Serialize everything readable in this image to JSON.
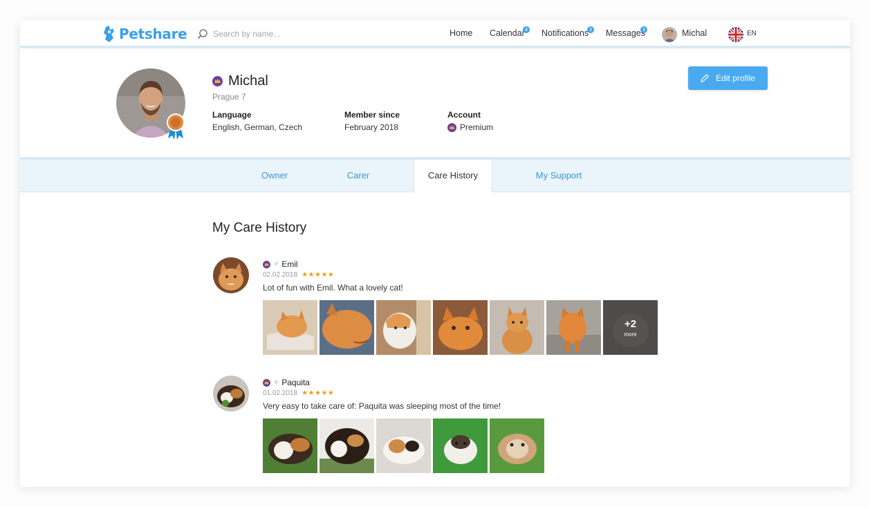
{
  "brand": {
    "name": "Petshare",
    "accent": "#3aa0e6"
  },
  "search": {
    "placeholder": "Search by name..."
  },
  "nav": {
    "home": "Home",
    "calendar": {
      "label": "Calendar",
      "badge": "4"
    },
    "notifications": {
      "label": "Notifications",
      "badge": "3"
    },
    "messages": {
      "label": "Messages",
      "badge": "3"
    },
    "user": "Michal",
    "language": "EN"
  },
  "profile": {
    "name": "Michal",
    "city": "Prague 7",
    "language_label": "Language",
    "language_value": "English, German, Czech",
    "member_label": "Member since",
    "member_value": "February 2018",
    "account_label": "Account",
    "account_value": "Premium",
    "edit_button": "Edit profile"
  },
  "tabs": [
    {
      "label": "Owner",
      "active": false
    },
    {
      "label": "Carer",
      "active": false
    },
    {
      "label": "Care History",
      "active": true
    },
    {
      "label": "My Support",
      "active": false
    }
  ],
  "history": {
    "title": "My Care History",
    "entries": [
      {
        "pet": "Emil",
        "gender": "♂",
        "date": "02.02.2018",
        "rating": "★★★★★",
        "comment": "Lot of fun with Emil. What a lovely cat!",
        "photo_icons": [
          "cat-photo",
          "cat-photo",
          "cat-photo",
          "cat-photo",
          "cat-photo",
          "cat-photo",
          "cat-photo"
        ],
        "more_count": "+2",
        "more_label": "more"
      },
      {
        "pet": "Paquita",
        "gender": "♀",
        "date": "01.02.2018",
        "rating": "★★★★★",
        "comment": "Very easy to take care of: Paquita was sleeping most of the time!",
        "photo_icons": [
          "guinea-pig-photo",
          "guinea-pig-photo",
          "guinea-pig-photo",
          "guinea-pig-photo",
          "guinea-pig-photo"
        ]
      }
    ]
  },
  "colors": {
    "accent": "#4aaaf0",
    "tab_bg": "#eaf4fb",
    "premium": "#6a3fa0",
    "stars": "#f39c12"
  }
}
